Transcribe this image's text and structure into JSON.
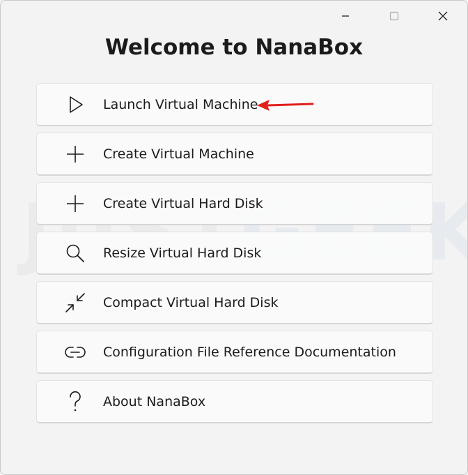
{
  "window": {
    "title": "Welcome to NanaBox",
    "caption_buttons": [
      {
        "name": "minimize",
        "icon": "minimize-icon"
      },
      {
        "name": "maximize",
        "icon": "maximize-icon"
      },
      {
        "name": "close",
        "icon": "close-icon"
      }
    ]
  },
  "watermark": {
    "part1": "JUST",
    "part2": "GEEK"
  },
  "menu": [
    {
      "label": "Launch Virtual Machine",
      "icon": "play-icon"
    },
    {
      "label": "Create Virtual Machine",
      "icon": "plus-icon"
    },
    {
      "label": "Create Virtual Hard Disk",
      "icon": "plus-icon"
    },
    {
      "label": "Resize Virtual Hard Disk",
      "icon": "search-icon"
    },
    {
      "label": "Compact Virtual Hard Disk",
      "icon": "compress-icon"
    },
    {
      "label": "Configuration File Reference Documentation",
      "icon": "link-icon"
    },
    {
      "label": "About NanaBox",
      "icon": "help-icon"
    }
  ],
  "annotation": {
    "arrow_color": "#e0201c",
    "points_to": "Launch Virtual Machine"
  }
}
